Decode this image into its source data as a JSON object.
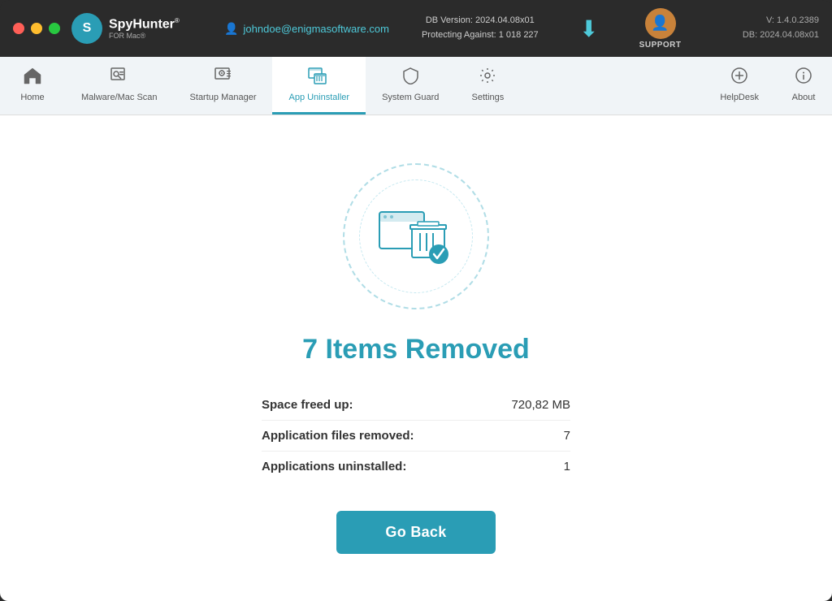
{
  "window": {
    "title": "SpyHunter for Mac"
  },
  "titlebar": {
    "logo_text": "SpyHunter",
    "logo_superscript": "®",
    "logo_for_mac": "FOR Mac®",
    "user_email": "johndoe@enigmasoftware.com",
    "db_version_label": "DB Version: 2024.04.08x01",
    "protecting_against_label": "Protecting Against: 1 018 227",
    "support_label": "SUPPORT",
    "version_line1": "V: 1.4.0.2389",
    "version_line2": "DB:  2024.04.08x01"
  },
  "navbar": {
    "items": [
      {
        "id": "home",
        "label": "Home",
        "icon": "🏠",
        "active": false
      },
      {
        "id": "malware-scan",
        "label": "Malware/Mac Scan",
        "icon": "🔍",
        "active": false
      },
      {
        "id": "startup-manager",
        "label": "Startup Manager",
        "icon": "⚙",
        "active": false
      },
      {
        "id": "app-uninstaller",
        "label": "App Uninstaller",
        "icon": "🗑",
        "active": true
      },
      {
        "id": "system-guard",
        "label": "System Guard",
        "icon": "🛡",
        "active": false
      },
      {
        "id": "settings",
        "label": "Settings",
        "icon": "⚙",
        "active": false
      }
    ],
    "right_items": [
      {
        "id": "helpdesk",
        "label": "HelpDesk",
        "icon": "➕"
      },
      {
        "id": "about",
        "label": "About",
        "icon": "ℹ"
      }
    ]
  },
  "main": {
    "result_title": "7 Items Removed",
    "stats": [
      {
        "label": "Space freed up:",
        "value": "720,82 MB"
      },
      {
        "label": "Application files removed:",
        "value": "7"
      },
      {
        "label": "Applications uninstalled:",
        "value": "1"
      }
    ],
    "go_back_label": "Go Back"
  }
}
